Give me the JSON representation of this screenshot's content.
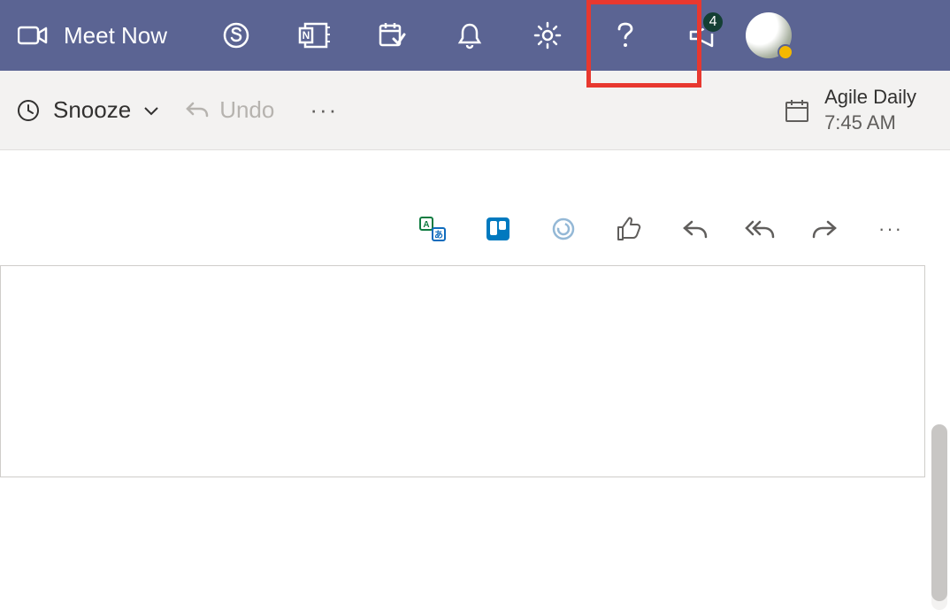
{
  "topbar": {
    "meet_now_label": "Meet Now",
    "megaphone_badge": "4"
  },
  "secondbar": {
    "snooze_label": "Snooze",
    "undo_label": "Undo",
    "ellipsis": "···"
  },
  "event": {
    "title": "Agile Daily",
    "time": "7:45 AM"
  },
  "toolbar": {
    "ellipsis": "···"
  },
  "colors": {
    "topbar_bg": "#5B6493",
    "highlight": "#E8382F"
  }
}
